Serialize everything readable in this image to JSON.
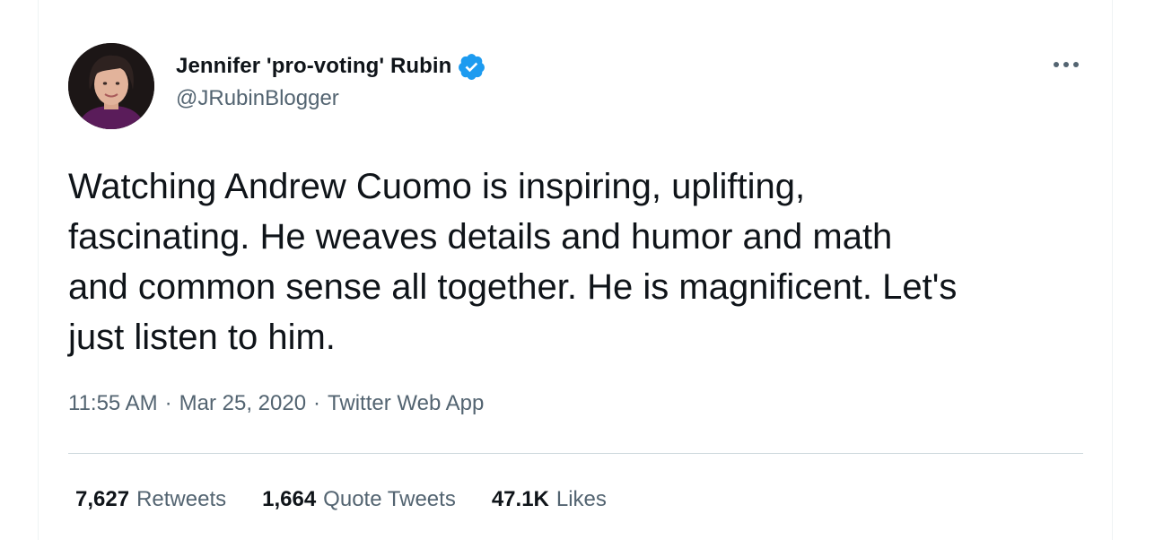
{
  "author": {
    "display_name": "Jennifer 'pro-voting' Rubin",
    "handle": "@JRubinBlogger",
    "verified": true,
    "verified_color": "#1d9bf0"
  },
  "tweet": {
    "text": "Watching Andrew Cuomo is inspiring, uplifting,\nfascinating. He weaves details and humor and math\nand common sense all together. He is magnificent. Let's\njust listen to him."
  },
  "meta": {
    "time": "11:55 AM",
    "date": "Mar 25, 2020",
    "source": "Twitter Web App",
    "separator": "·"
  },
  "stats": {
    "retweets": {
      "count": "7,627",
      "label": "Retweets"
    },
    "quote_tweets": {
      "count": "1,664",
      "label": "Quote Tweets"
    },
    "likes": {
      "count": "47.1K",
      "label": "Likes"
    }
  },
  "icons": {
    "more": "more-horizontal-icon",
    "verified": "verified-badge-icon"
  }
}
